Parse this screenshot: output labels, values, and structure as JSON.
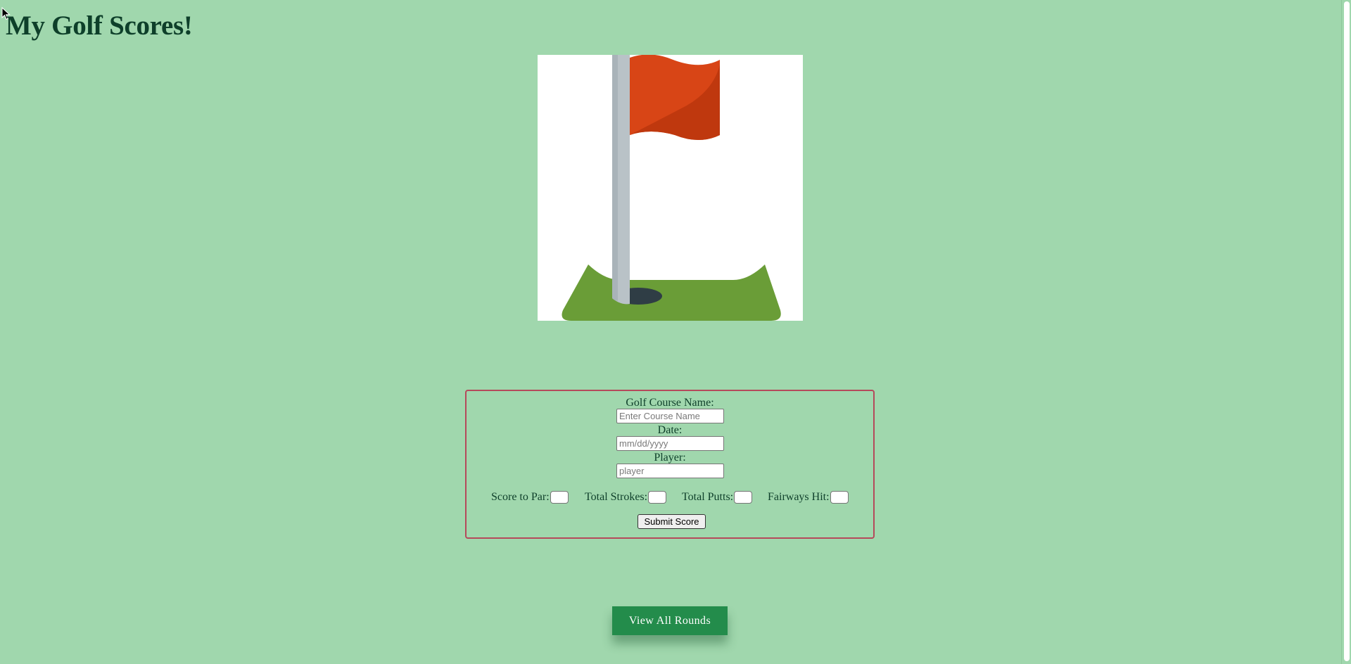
{
  "page": {
    "title": "My Golf Scores!",
    "background_color": "#a0d7ad",
    "text_color": "#0e3f2a"
  },
  "hero_image": {
    "icon": "golf-flag-hole-icon",
    "colors": {
      "flag": "#d84516",
      "flag_shade": "#bf380e",
      "pole": "#b9c2c7",
      "green": "#6a9d37",
      "hole": "#2f3d45"
    }
  },
  "form": {
    "border_color": "#b5495b",
    "course": {
      "label": "Golf Course Name:",
      "placeholder": "Enter Course Name",
      "value": ""
    },
    "date": {
      "label": "Date:",
      "placeholder": "mm/dd/yyyy",
      "value": ""
    },
    "player": {
      "label": "Player:",
      "placeholder": "player",
      "value": ""
    },
    "stats": {
      "score_to_par": {
        "label": "Score to Par:",
        "value": ""
      },
      "total_strokes": {
        "label": "Total Strokes:",
        "value": ""
      },
      "total_putts": {
        "label": "Total Putts:",
        "value": ""
      },
      "fairways_hit": {
        "label": "Fairways Hit:",
        "value": ""
      }
    },
    "submit_label": "Submit Score"
  },
  "view_all": {
    "label": "View All Rounds",
    "color": "#238c4b"
  }
}
